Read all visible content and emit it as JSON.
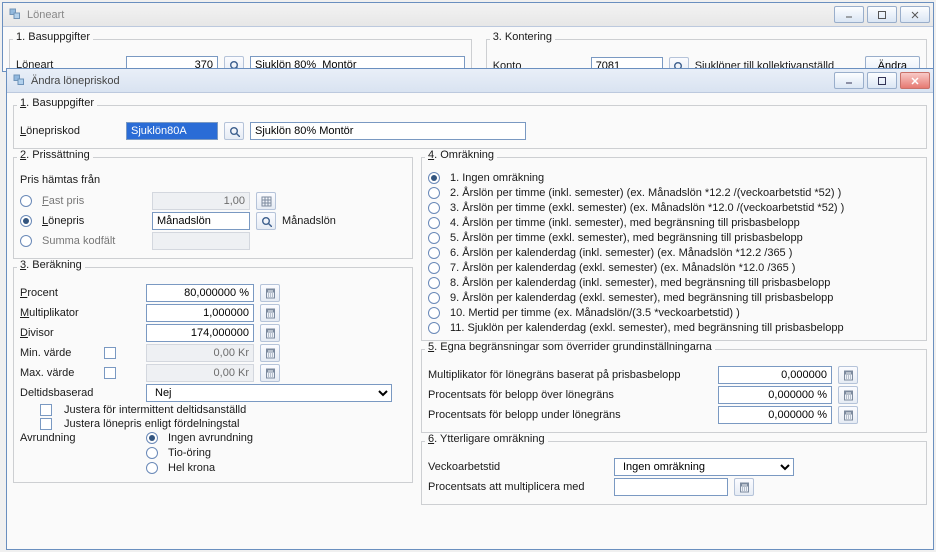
{
  "bgWindow": {
    "title": "Löneart",
    "group1": {
      "legend": "1. Basuppgifter",
      "label": "Löneart",
      "code": "370",
      "desc": "Sjuklön 80%  Montör"
    },
    "group2": {
      "legend": "3. Kontering",
      "label": "Konto",
      "code": "7081",
      "desc": "Sjuklöner till kollektivanställd",
      "button": "Ändra"
    }
  },
  "fgWindow": {
    "title": "Ändra lönepriskod",
    "g1": {
      "legend": "1. Basuppgifter",
      "label": "Lönepriskod",
      "code": "Sjuklön80A",
      "desc": "Sjuklön 80% Montör"
    },
    "g2": {
      "legend": "2. Prissättning",
      "sub": "Pris hämtas från",
      "fast": "Fast pris",
      "fastVal": "1,00",
      "lonepris": "Lönepris",
      "loneprisVal": "Månadslön",
      "loneprisDesc": "Månadslön",
      "summa": "Summa kodfält"
    },
    "g3": {
      "legend": "3. Beräkning",
      "procent": "Procent",
      "procentVal": "80,000000 %",
      "mult": "Multiplikator",
      "multVal": "1,000000",
      "div": "Divisor",
      "divVal": "174,000000",
      "min": "Min. värde",
      "minVal": "0,00 Kr",
      "max": "Max. värde",
      "maxVal": "0,00 Kr",
      "del": "Deltidsbaserad",
      "delVal": "Nej",
      "just1": "Justera för intermittent deltidsanställd",
      "just2": "Justera lönepris enligt fördelningstal",
      "avr": "Avrundning",
      "avr1": "Ingen avrundning",
      "avr2": "Tio-öring",
      "avr3": "Hel krona"
    },
    "g4": {
      "legend": "4. Omräkning",
      "opts": [
        "1. Ingen omräkning",
        "2. Årslön per timme (inkl. semester)  (ex. Månadslön *12.2 /(veckoarbetstid *52) )",
        "3. Årslön per timme (exkl. semester)  (ex. Månadslön *12.0 /(veckoarbetstid *52) )",
        "4. Årslön per timme (inkl. semester), med begränsning till prisbasbelopp",
        "5. Årslön per timme (exkl. semester), med begränsning till prisbasbelopp",
        "6. Årslön per kalenderdag (inkl. semester)  (ex. Månadslön *12.2 /365 )",
        "7. Årslön per kalenderdag (exkl. semester)  (ex. Månadslön *12.0 /365 )",
        "8. Årslön per kalenderdag (inkl. semester), med begränsning till prisbasbelopp",
        "9. Årslön per kalenderdag (exkl. semester), med begränsning till prisbasbelopp",
        "10. Mertid per timme (ex. Månadslön/(3.5 *veckoarbetstid) )",
        "11. Sjuklön per kalenderdag (exkl. semester), med begränsning till prisbasbelopp"
      ]
    },
    "g5": {
      "legend": "5. Egna begränsningar som överrider grundinställningarna",
      "m": "Multiplikator för lönegräns baserat på prisbasbelopp",
      "mVal": "0,000000",
      "o": "Procentsats för belopp över lönegräns",
      "oVal": "0,000000 %",
      "u": "Procentsats för belopp under lönegräns",
      "uVal": "0,000000 %"
    },
    "g6": {
      "legend": "6. Ytterligare omräkning",
      "v": "Veckoarbetstid",
      "vVal": "Ingen omräkning",
      "p": "Procentsats att multiplicera med"
    }
  }
}
